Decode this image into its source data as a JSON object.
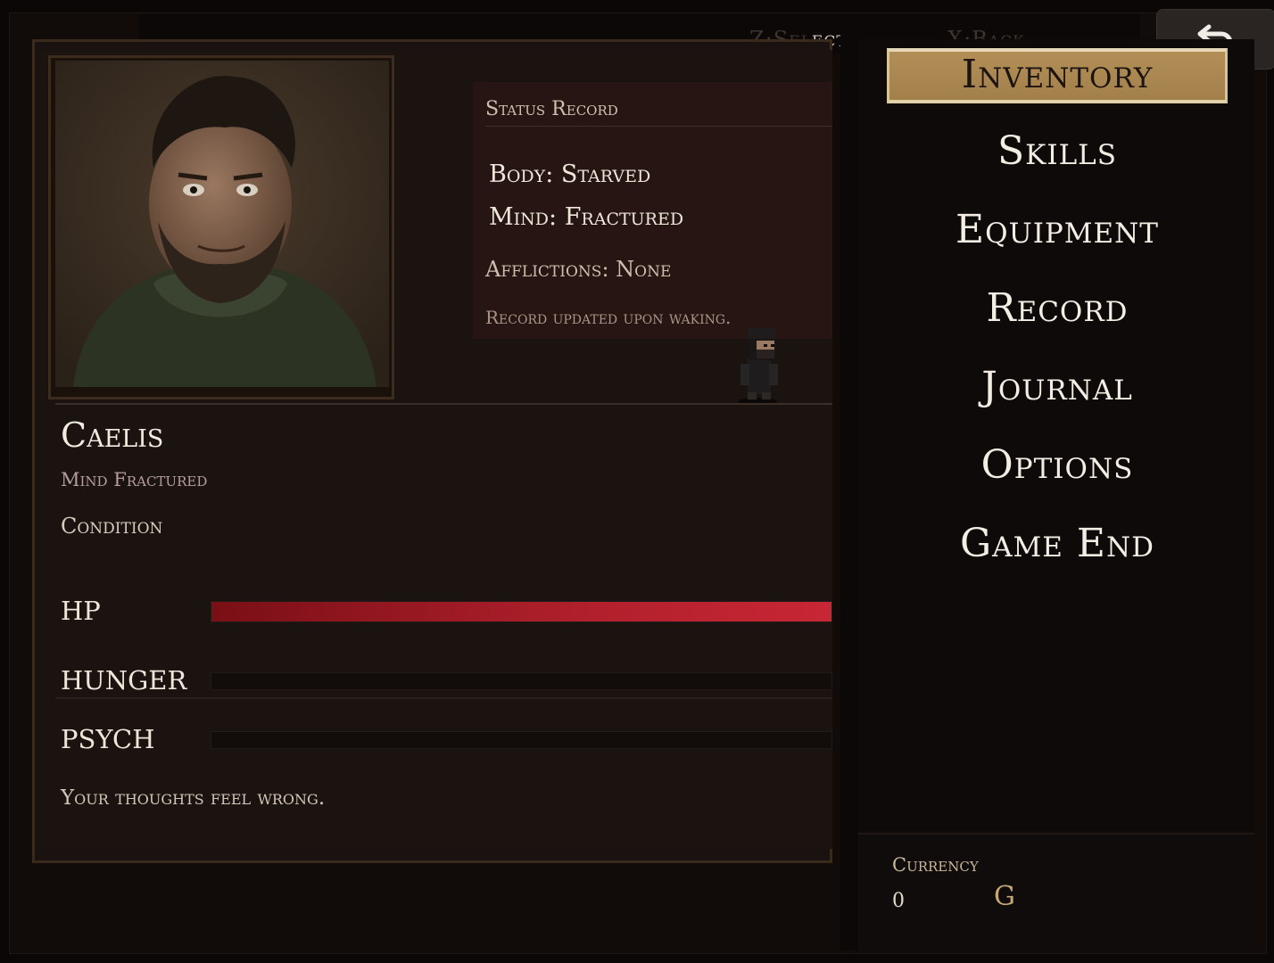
{
  "controls": {
    "select_dim": "Z:Sel",
    "select_lit": "ect",
    "back_hint": "X:Back",
    "back_icon": "undo-arrow"
  },
  "status": {
    "title": "Status Record",
    "body": "Body: Starved",
    "mind": "Mind: Fractured",
    "afflictions": "Afflictions: None",
    "note": "Record updated upon waking."
  },
  "character": {
    "name": "Caelis",
    "state": "Mind Fractured",
    "condition": "Condition",
    "flavor": "Your thoughts feel wrong."
  },
  "stats": [
    {
      "label": "HP",
      "fill": 1.0,
      "color": "#c82634"
    },
    {
      "label": "HUNGER",
      "fill": 0.0
    },
    {
      "label": "PSYCH",
      "fill": 0.0
    }
  ],
  "menu": {
    "items": [
      "Inventory",
      "Skills",
      "Equipment",
      "Record",
      "Journal",
      "Options",
      "Game End"
    ],
    "selected": "Inventory"
  },
  "currency": {
    "label": "Currency",
    "amount": "0",
    "unit": "G"
  },
  "colors": {
    "accent_gold": "#b28f57",
    "hp_red": "#c82634",
    "panel_bg": "#1a1210"
  }
}
